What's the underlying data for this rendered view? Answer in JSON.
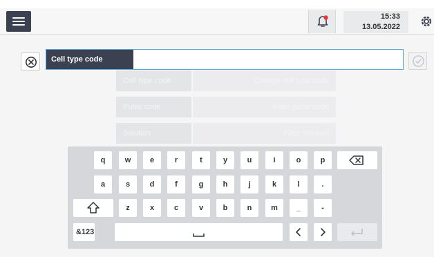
{
  "header": {
    "time": "15:33",
    "date": "13.05.2022"
  },
  "background_form": {
    "rows": [
      {
        "label": "Cell type code",
        "value": "Change cell type code"
      },
      {
        "label": "Pulse code",
        "value": "Filter pulse code"
      },
      {
        "label": "Solution",
        "value": "Filter solution"
      }
    ]
  },
  "input": {
    "label": "Cell type code",
    "value": ""
  },
  "keyboard": {
    "row1": [
      "q",
      "w",
      "e",
      "r",
      "t",
      "y",
      "u",
      "i",
      "o",
      "p"
    ],
    "row2": [
      "a",
      "s",
      "d",
      "f",
      "g",
      "h",
      "j",
      "k",
      "l",
      "."
    ],
    "row3": [
      "z",
      "x",
      "c",
      "v",
      "b",
      "n",
      "m",
      "_",
      "-"
    ],
    "symbols_label": "&123"
  },
  "icons": {
    "menu": "menu-icon",
    "alarm": "bell-alert-icon",
    "settings": "gear-icon",
    "clear": "close-circle-icon",
    "confirm": "check-circle-icon",
    "backspace": "backspace-icon",
    "shift": "shift-icon",
    "space": "space-icon",
    "left": "chevron-left-icon",
    "right": "chevron-right-icon",
    "enter": "enter-icon"
  },
  "colors": {
    "dark": "#3b4150",
    "accent_alert": "#e8353e",
    "input_border": "#5aa6d9"
  }
}
